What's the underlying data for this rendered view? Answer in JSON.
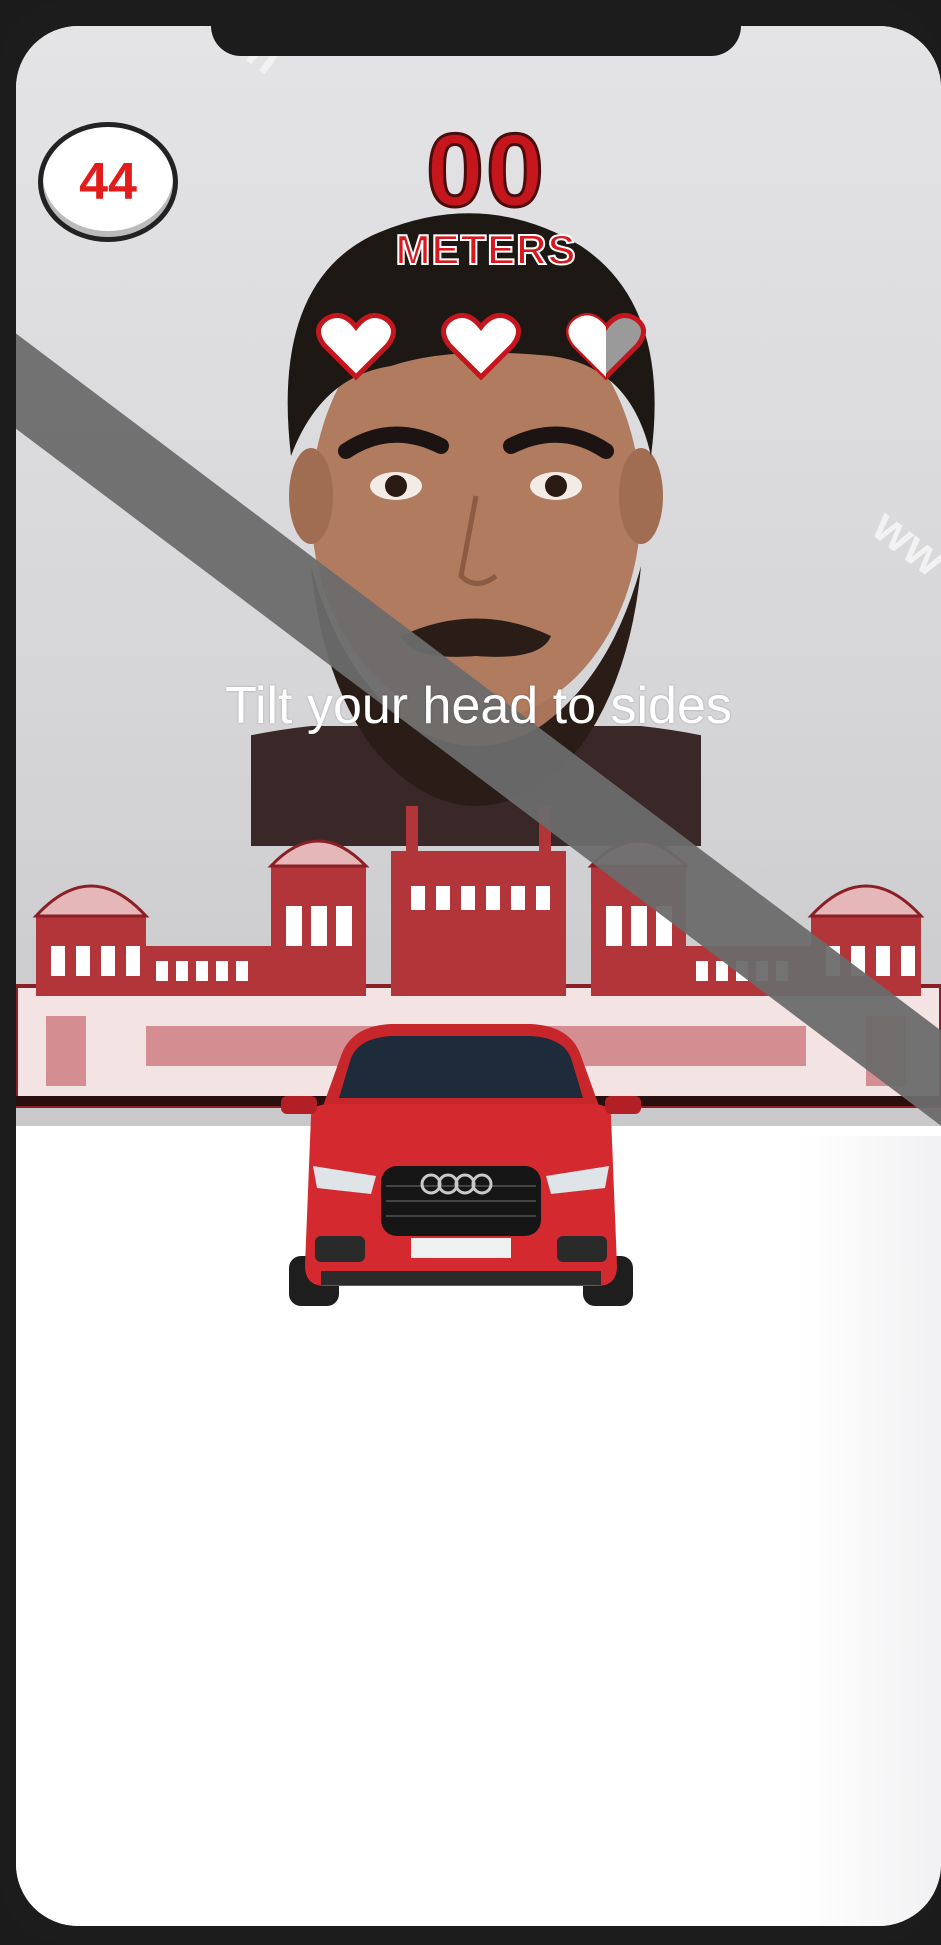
{
  "timer": {
    "value": "44"
  },
  "distance": {
    "value": "00",
    "unit": "METERS"
  },
  "lives": {
    "total": 3,
    "remaining": 2
  },
  "instruction": "Tilt your head to sides",
  "watermark": {
    "text_top": "w.in",
    "text_right": "ww"
  },
  "colors": {
    "accent": "#c4161c",
    "car": "#d42a2f",
    "fort": "#b2353a"
  }
}
